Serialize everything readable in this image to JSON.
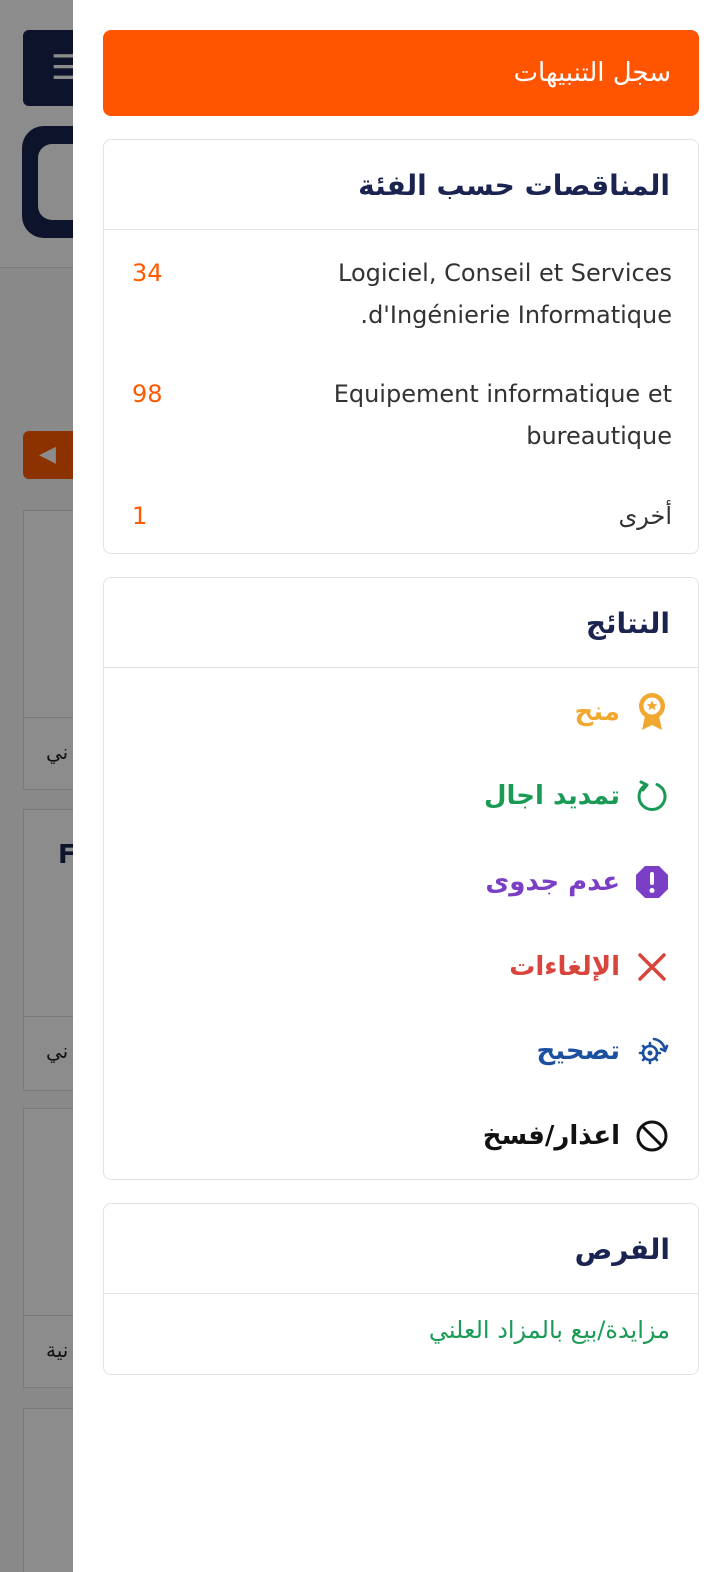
{
  "background": {
    "menu_glyph": "☰",
    "nav_glyph": "◀",
    "card_title_fragment": "F",
    "row_fragments": [
      "ني",
      "ني",
      "نية"
    ]
  },
  "panel": {
    "alert_log_label": "سجل التنبيهات",
    "categories": {
      "title": "المناقصات حسب الفئة",
      "items": [
        {
          "label": "Logiciel, Conseil et Services d'Ingénierie Informatique.",
          "count": "34"
        },
        {
          "label": "Equipement informatique et bureautique",
          "count": "98"
        },
        {
          "label": "أخرى",
          "count": "1"
        }
      ]
    },
    "results": {
      "title": "النتائج",
      "items": [
        {
          "label": "منح",
          "icon": "award-icon",
          "color": "#f0a830"
        },
        {
          "label": "تمديد اجال",
          "icon": "refresh-icon",
          "color": "#1a9b55"
        },
        {
          "label": "عدم جدوى",
          "icon": "warning-octagon-icon",
          "color": "#7a3fc4"
        },
        {
          "label": "الإلغاءات",
          "icon": "close-icon",
          "color": "#d9453d"
        },
        {
          "label": "تصحيح",
          "icon": "gear-refresh-icon",
          "color": "#1b4fa0"
        },
        {
          "label": "اعذار/فسخ",
          "icon": "ban-icon",
          "color": "#111111"
        }
      ]
    },
    "opportunities": {
      "title": "الفرص",
      "items": [
        {
          "label": "مزايدة/بيع بالمزاد العلني"
        }
      ]
    }
  }
}
